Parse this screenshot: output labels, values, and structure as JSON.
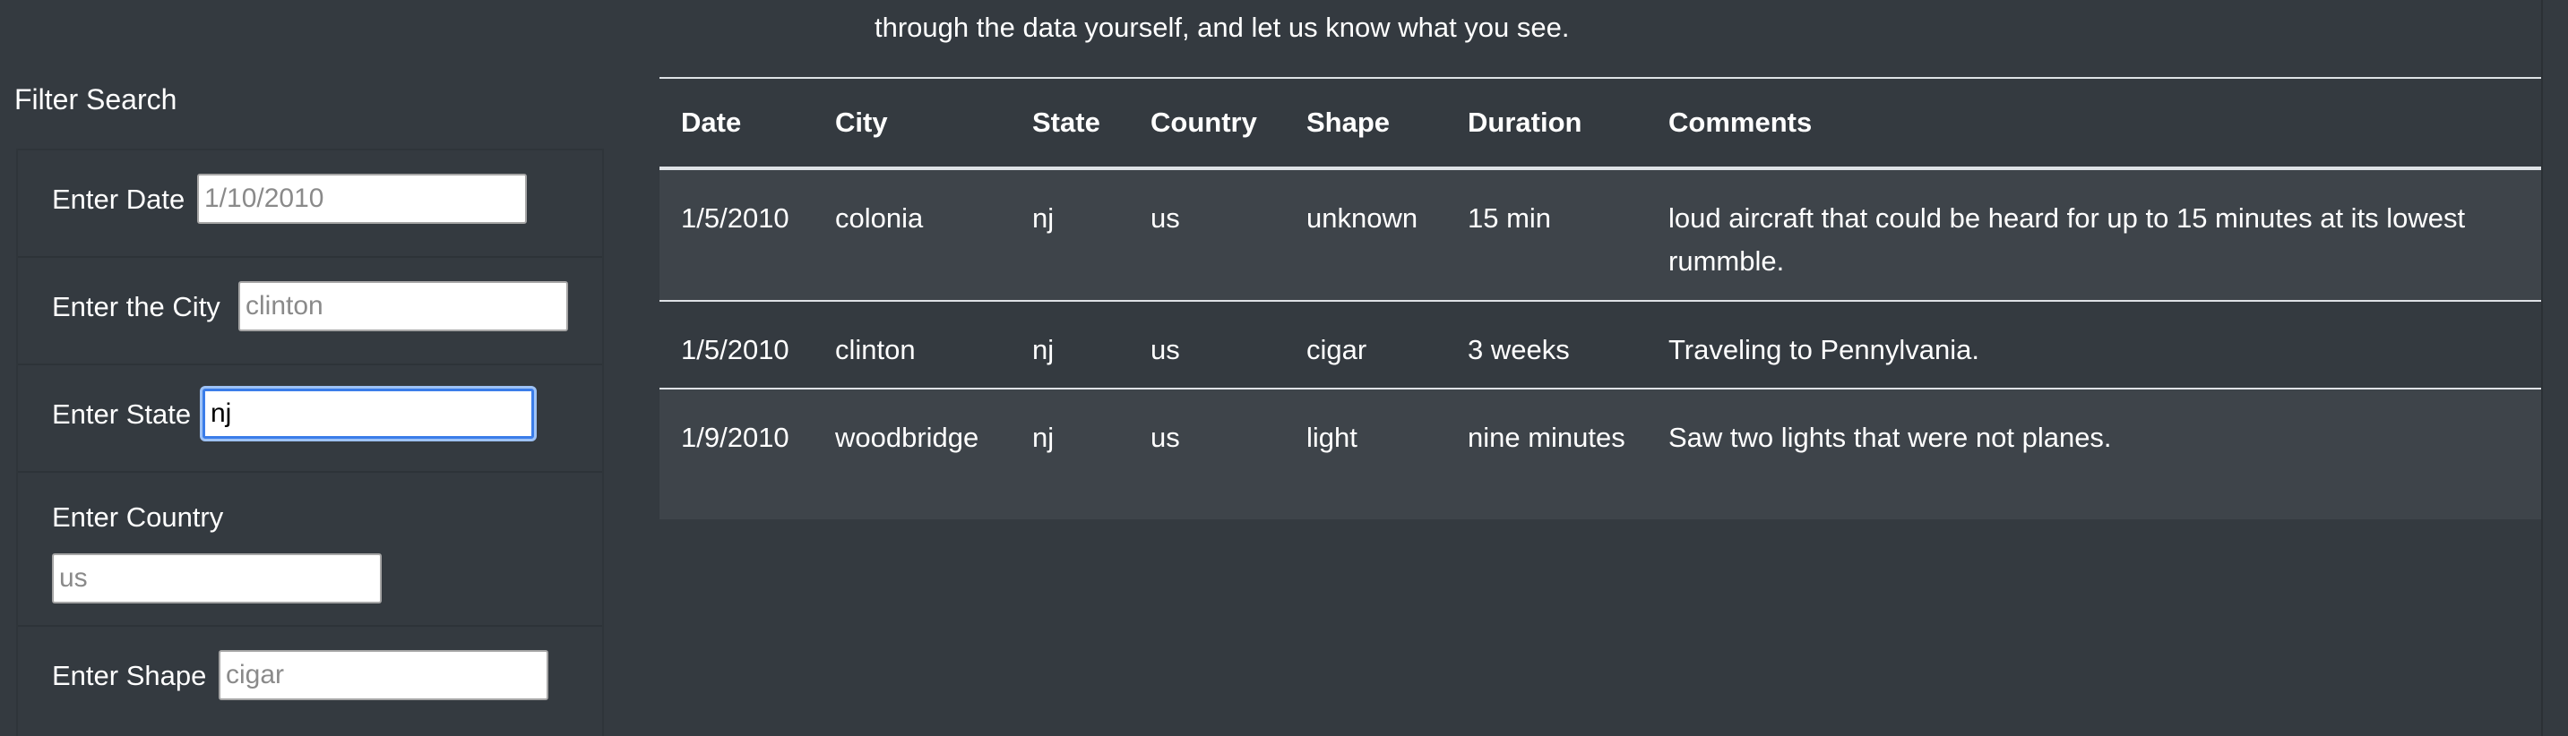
{
  "intro_text": "through the data yourself, and let us know what you see.",
  "filter": {
    "title": "Filter Search",
    "fields": [
      {
        "label": "Enter Date",
        "value": "",
        "placeholder": "1/10/2010"
      },
      {
        "label": "Enter the City",
        "value": "",
        "placeholder": "clinton"
      },
      {
        "label": "Enter State",
        "value": "nj",
        "placeholder": ""
      },
      {
        "label": "Enter Country",
        "value": "",
        "placeholder": "us"
      },
      {
        "label": "Enter Shape",
        "value": "",
        "placeholder": "cigar"
      }
    ]
  },
  "table": {
    "headers": [
      "Date",
      "City",
      "State",
      "Country",
      "Shape",
      "Duration",
      "Comments"
    ],
    "rows": [
      [
        "1/5/2010",
        "colonia",
        "nj",
        "us",
        "unknown",
        "15 min",
        "loud aircraft that could be heard for up to 15 minutes at its lowest rummble."
      ],
      [
        "1/5/2010",
        "clinton",
        "nj",
        "us",
        "cigar",
        "3 weeks",
        "Traveling to Pennylvania."
      ],
      [
        "1/9/2010",
        "woodbridge",
        "nj",
        "us",
        "light",
        "nine minutes",
        "Saw two lights that were not planes."
      ]
    ]
  }
}
